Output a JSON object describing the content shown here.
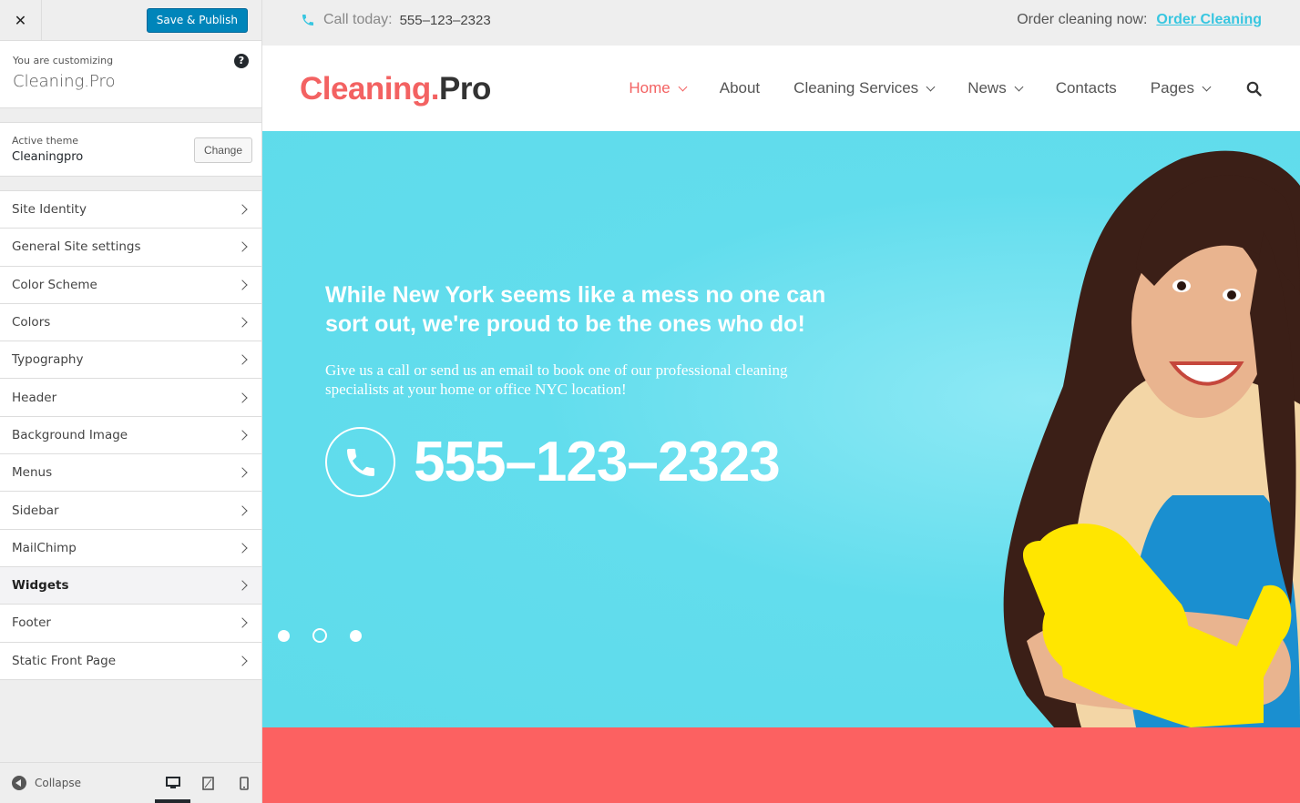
{
  "customizer": {
    "close_icon": "close-icon",
    "save_label": "Save & Publish",
    "customizing_label": "You are customizing",
    "site_name": "Cleaning.Pro",
    "help_glyph": "?",
    "active_theme_label": "Active theme",
    "theme_name": "Cleaningpro",
    "change_label": "Change",
    "sections": [
      {
        "label": "Site Identity"
      },
      {
        "label": "General Site settings"
      },
      {
        "label": "Color Scheme"
      },
      {
        "label": "Colors"
      },
      {
        "label": "Typography"
      },
      {
        "label": "Header"
      },
      {
        "label": "Background Image"
      },
      {
        "label": "Menus"
      },
      {
        "label": "Sidebar"
      },
      {
        "label": "MailChimp"
      },
      {
        "label": "Widgets",
        "active": true
      },
      {
        "label": "Footer"
      },
      {
        "label": "Static Front Page"
      }
    ],
    "collapse_label": "Collapse",
    "devices": [
      "desktop",
      "tablet",
      "mobile"
    ],
    "active_device": "desktop"
  },
  "site": {
    "topbar": {
      "call_label": "Call today:",
      "call_number": "555–123–2323",
      "order_label": "Order cleaning now:",
      "order_link": "Order Cleaning"
    },
    "logo": {
      "part1": "Cleaning.",
      "part2": "Pro"
    },
    "nav": [
      {
        "label": "Home",
        "dropdown": true,
        "active": true
      },
      {
        "label": "About",
        "dropdown": false
      },
      {
        "label": "Cleaning Services",
        "dropdown": true
      },
      {
        "label": "News",
        "dropdown": true
      },
      {
        "label": "Contacts",
        "dropdown": false
      },
      {
        "label": "Pages",
        "dropdown": true
      }
    ],
    "hero": {
      "title": "While New York seems like a mess no one can sort out, we're proud to be the ones who do!",
      "text": "Give us a call or send us an email to book one of our professional cleaning specialists at your home or office NYC location!",
      "phone": "555–123–2323",
      "slides": 3,
      "active_slide": 2
    }
  },
  "colors": {
    "accent_red": "#f36262",
    "accent_cyan": "#38c6e0",
    "hero_bg": "#5edbea",
    "wp_blue": "#0085ba",
    "band_red": "#fc6161"
  }
}
